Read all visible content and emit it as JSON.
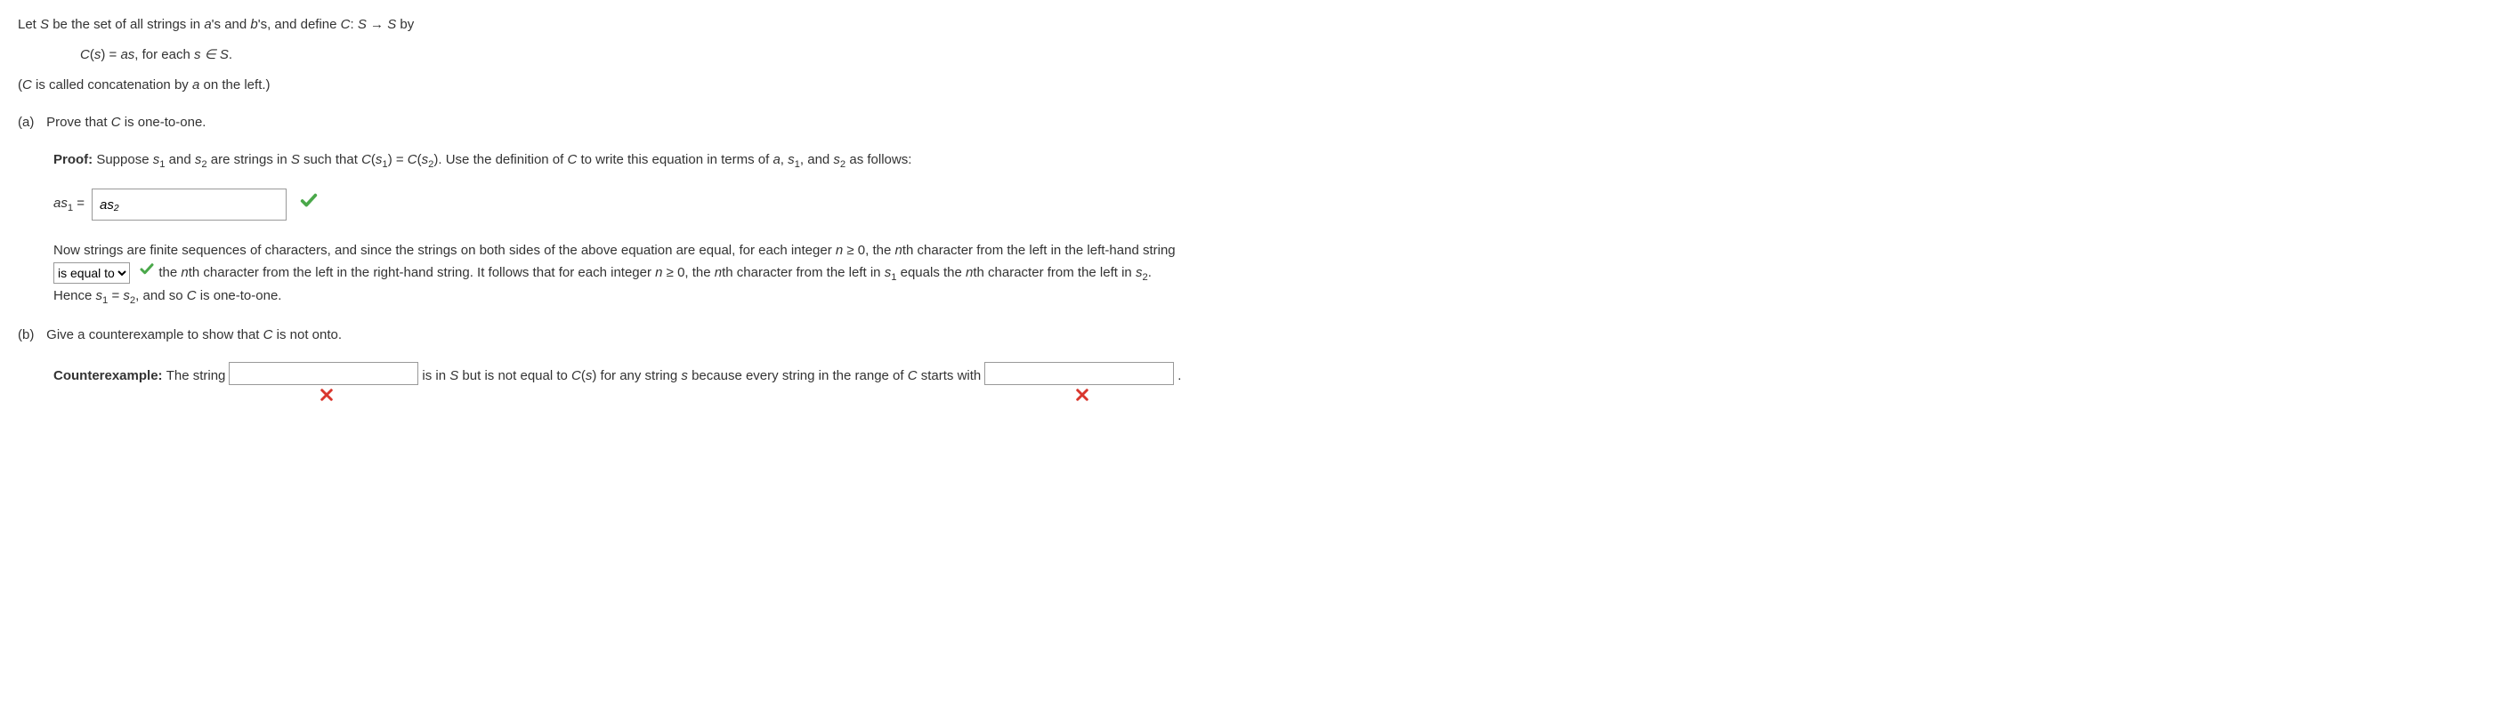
{
  "intro": {
    "line1_pre": "Let ",
    "line1_S": "S",
    "line1_mid": " be the set of all strings in ",
    "line1_a": "a",
    "line1_and": "'s and ",
    "line1_b": "b",
    "line1_end": "'s, and define ",
    "line1_C": "C",
    "line1_map": ": ",
    "line1_Sarrow": "S → S",
    "line1_by": " by",
    "defn_pre": "C",
    "defn_paren": "(",
    "defn_s": "s",
    "defn_eq": ") = ",
    "defn_as": "as",
    "defn_end": ", for each ",
    "defn_in": "s ∈ S",
    "defn_dot": ".",
    "explain_pre": "(",
    "explain_C": "C",
    "explain_mid": " is called concatenation by ",
    "explain_a": "a",
    "explain_end": " on the left.)"
  },
  "partA": {
    "label": "(a)",
    "prompt_pre": "Prove that ",
    "prompt_C": "C",
    "prompt_end": " is one-to-one.",
    "proof_label": "Proof: ",
    "proof_pre": "Suppose ",
    "proof_s1": "s",
    "proof_and": " and ",
    "proof_s2": "s",
    "proof_mid1": " are strings in ",
    "proof_S": "S",
    "proof_mid2": " such that ",
    "proof_Cs1": "C",
    "proof_paren1": "(",
    "proof_s1b": "s",
    "proof_eq1": ") = ",
    "proof_Cs2": "C",
    "proof_s2b": "s",
    "proof_end1": "). Use the definition of ",
    "proof_C3": "C",
    "proof_mid3": " to write this equation in terms of ",
    "proof_a": "a",
    "proof_comma1": ", ",
    "proof_s1c": "s",
    "proof_comma2": ", and ",
    "proof_s2c": "s",
    "proof_end2": " as follows:",
    "eq_lhs_a": "as",
    "eq_eq": " = ",
    "input_value": "as₂",
    "para2_pre": "Now strings are finite sequences of characters, and since the strings on both sides of the above equation are equal, for each integer ",
    "para2_n": "n",
    "para2_ge": " ≥ 0, the ",
    "para2_nth": "n",
    "para2_mid1": "th character from the left in the left-hand string ",
    "dropdown_value": "is equal to",
    "para2_mid2": " the ",
    "para2_nth2": "n",
    "para2_mid3": "th character from the left in the right-hand string. It follows that for each integer ",
    "para2_n2": "n",
    "para2_ge2": " ≥ 0, the ",
    "para2_nth3": "n",
    "para2_mid4": "th character from the left in ",
    "para2_s1": "s",
    "para2_mid5": " equals the ",
    "para2_nth4": "n",
    "para2_mid6": "th character from the left in ",
    "para2_s2": "s",
    "para2_dot": ".",
    "para3_pre": "Hence ",
    "para3_s1": "s",
    "para3_eq": " = ",
    "para3_s2": "s",
    "para3_mid": ", and so ",
    "para3_C": "C",
    "para3_end": " is one-to-one."
  },
  "partB": {
    "label": "(b)",
    "prompt_pre": "Give a counterexample to show that ",
    "prompt_C": "C",
    "prompt_end": " is not onto.",
    "ce_label": "Counterexample: ",
    "ce_pre": "The string ",
    "input1_value": "",
    "ce_mid1": " is in ",
    "ce_S": "S",
    "ce_mid2": " but is not equal to ",
    "ce_C": "C",
    "ce_paren": "(",
    "ce_s": "s",
    "ce_mid3": ") for any string ",
    "ce_s2": "s",
    "ce_mid4": " because every string in the range of ",
    "ce_C2": "C",
    "ce_mid5": " starts with ",
    "input2_value": "",
    "ce_dot": "."
  },
  "sub": {
    "one": "1",
    "two": "2"
  }
}
